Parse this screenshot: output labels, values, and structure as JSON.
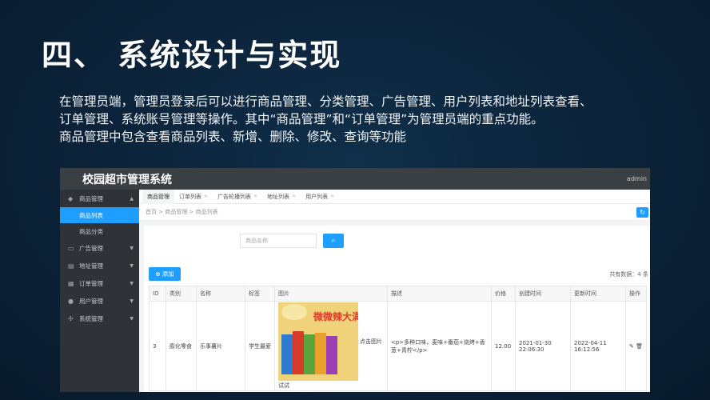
{
  "slide": {
    "title": "四、 系统设计与实现",
    "desc": [
      "在管理员端，管理员登录后可以进行商品管理、分类管理、广告管理、用户列表和地址列表查看、",
      "订单管理、系统账号管理等操作。其中“商品管理”和“订单管理”为管理员端的重点功能。",
      "商品管理中包含查看商品列表、新增、删除、修改、查询等功能"
    ]
  },
  "app": {
    "title": "校园超市管理系统",
    "user": "admin",
    "sidebar": {
      "groups": [
        {
          "label": "商品管理",
          "icon": "tag-icon",
          "arrow": "▲"
        },
        {
          "label": "广告管理",
          "icon": "ad-icon",
          "arrow": "▼"
        },
        {
          "label": "地址管理",
          "icon": "address-icon",
          "arrow": "▼"
        },
        {
          "label": "订单管理",
          "icon": "order-icon",
          "arrow": "▼"
        },
        {
          "label": "用户管理",
          "icon": "user-icon",
          "arrow": "▼"
        },
        {
          "label": "系统管理",
          "icon": "settings-icon",
          "arrow": "▼"
        }
      ],
      "sub_items": [
        {
          "label": "商品列表"
        },
        {
          "label": "商品分类"
        }
      ]
    },
    "tabs": [
      {
        "label": "商品管理"
      },
      {
        "label": "订单列表"
      },
      {
        "label": "广告轮播列表"
      },
      {
        "label": "地址列表"
      },
      {
        "label": "用户列表"
      }
    ],
    "breadcrumb": "首页 > 商品管理 > 商品列表",
    "search": {
      "placeholder": "商品名称",
      "button_icon": "search-icon"
    },
    "add_label": "添加",
    "total": "共有数据：4 条",
    "table": {
      "headers": [
        "ID",
        "类别",
        "名称",
        "标签",
        "图片",
        "描述",
        "价格",
        "创建时间",
        "更新时间",
        "操作"
      ],
      "row": {
        "id": "3",
        "category": "膨化零食",
        "name": "乐事薯片",
        "tag": "学生最爱",
        "image_caption": "点击图片",
        "image_test": "试试",
        "image_text": "微微辣大满足",
        "description": "<p>多种口味，麦味+番茄+烧烤+香葱+青柠</p>",
        "price": "12.00",
        "created": "2021-01-30 22:06:30",
        "updated": "2022-04-11 16:12:56",
        "ops": "✎ 🗑"
      }
    }
  }
}
